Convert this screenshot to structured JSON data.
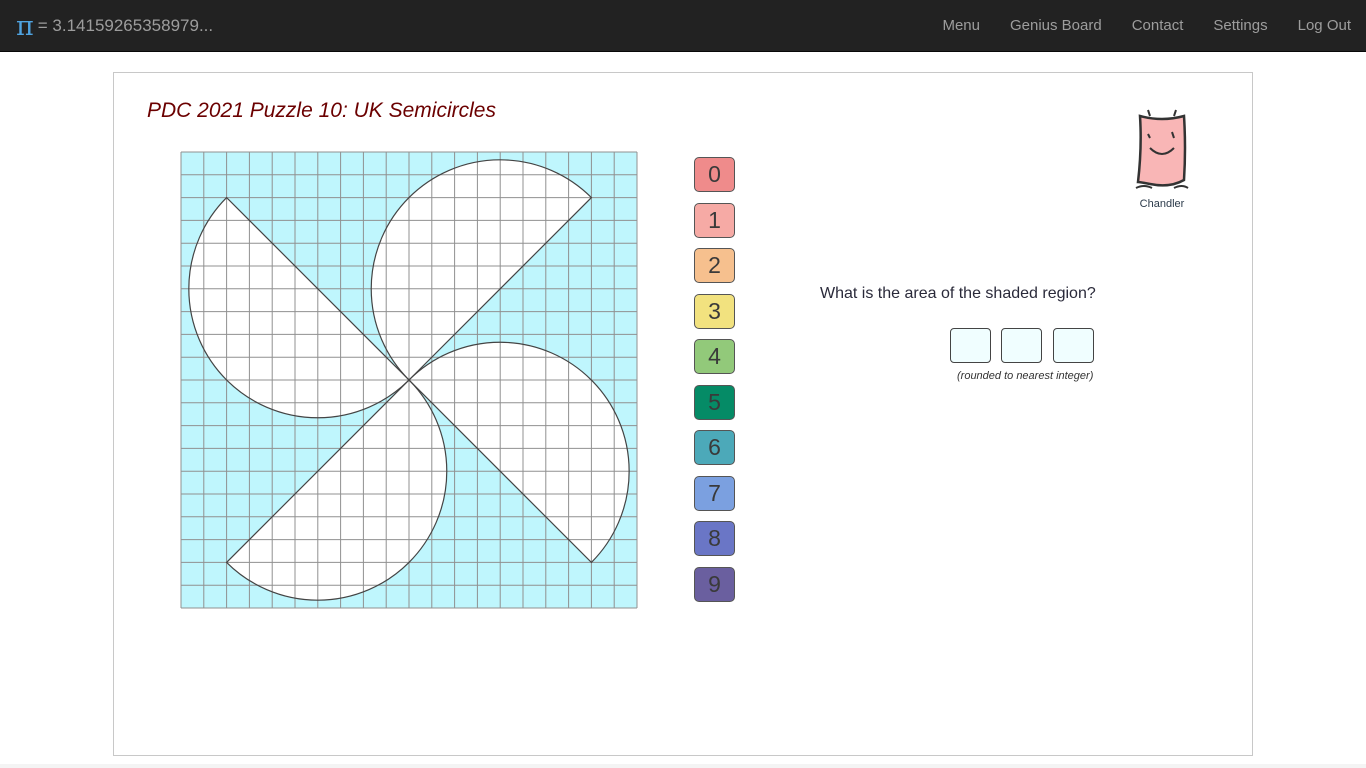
{
  "navbar": {
    "brand_symbol": "π",
    "brand_text": "= 3.14159265358979...",
    "links": [
      {
        "label": "Menu"
      },
      {
        "label": "Genius Board"
      },
      {
        "label": "Contact"
      },
      {
        "label": "Settings"
      },
      {
        "label": "Log Out"
      }
    ]
  },
  "puzzle": {
    "title": "PDC 2021 Puzzle 10: UK Semicircles",
    "grid_cells": 20,
    "shaded_color": "#bff6fd",
    "grid_line_color": "#909090"
  },
  "keypad": {
    "digits": [
      {
        "label": "0",
        "color": "#ef8b8b"
      },
      {
        "label": "1",
        "color": "#f6aaa5"
      },
      {
        "label": "2",
        "color": "#f6c08e"
      },
      {
        "label": "3",
        "color": "#f2e27f"
      },
      {
        "label": "4",
        "color": "#92c97a"
      },
      {
        "label": "5",
        "color": "#058b66"
      },
      {
        "label": "6",
        "color": "#4ca9b9"
      },
      {
        "label": "7",
        "color": "#7ba0e0"
      },
      {
        "label": "8",
        "color": "#6a76c6"
      },
      {
        "label": "9",
        "color": "#6a5f9f"
      }
    ]
  },
  "avatar": {
    "name": "Chandler",
    "color": "#f9b6b6"
  },
  "question": {
    "text": "What is the area of the shaded region?",
    "answer_digits": [
      "",
      "",
      ""
    ],
    "hint": "(rounded to nearest integer)"
  }
}
